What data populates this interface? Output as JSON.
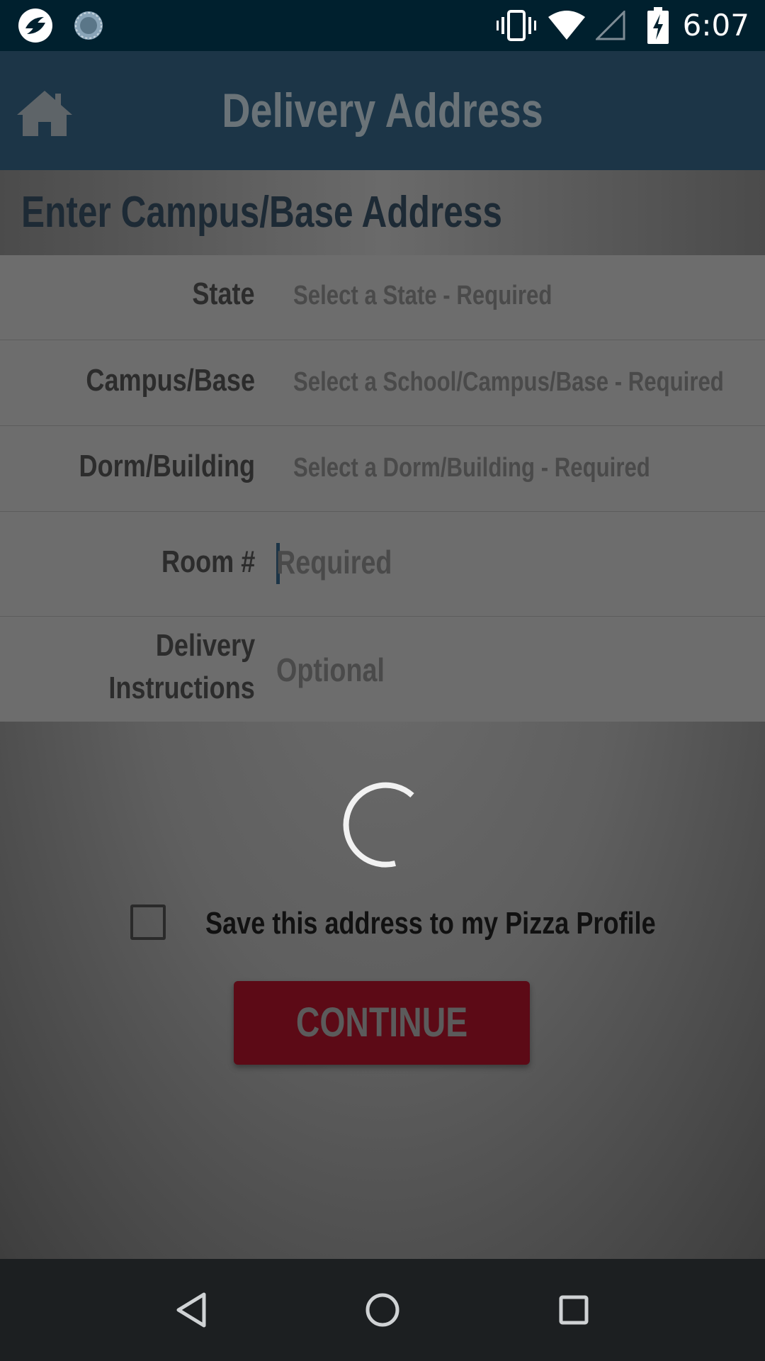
{
  "status_bar": {
    "time": "6:07",
    "icons": [
      "app-notification-icon",
      "sync-notification-icon",
      "vibrate-icon",
      "wifi-icon",
      "no-signal-icon",
      "battery-charging-icon"
    ]
  },
  "app_bar": {
    "title": "Delivery Address",
    "home_icon": "home-icon"
  },
  "section": {
    "title": "Enter Campus/Base Address"
  },
  "form": {
    "state": {
      "label": "State",
      "value": "Select a State - Required"
    },
    "campus": {
      "label": "Campus/Base",
      "value": "Select a School/Campus/Base - Required"
    },
    "dorm": {
      "label": "Dorm/Building",
      "value": "Select a Dorm/Building - Required"
    },
    "room": {
      "label": "Room #",
      "placeholder": "Required"
    },
    "instructions": {
      "label_line1": "Delivery",
      "label_line2": "Instructions",
      "placeholder": "Optional"
    }
  },
  "save": {
    "label": "Save this address to my Pizza Profile",
    "checked": false
  },
  "continue_label": "CONTINUE",
  "colors": {
    "status_bar": "#00202e",
    "app_bar": "#1c3547",
    "continue_button": "#5c0a16",
    "nav_bar": "#1c1f21"
  },
  "nav_bar": {
    "icons": [
      "back-icon",
      "home-circle-icon",
      "recents-icon"
    ]
  }
}
